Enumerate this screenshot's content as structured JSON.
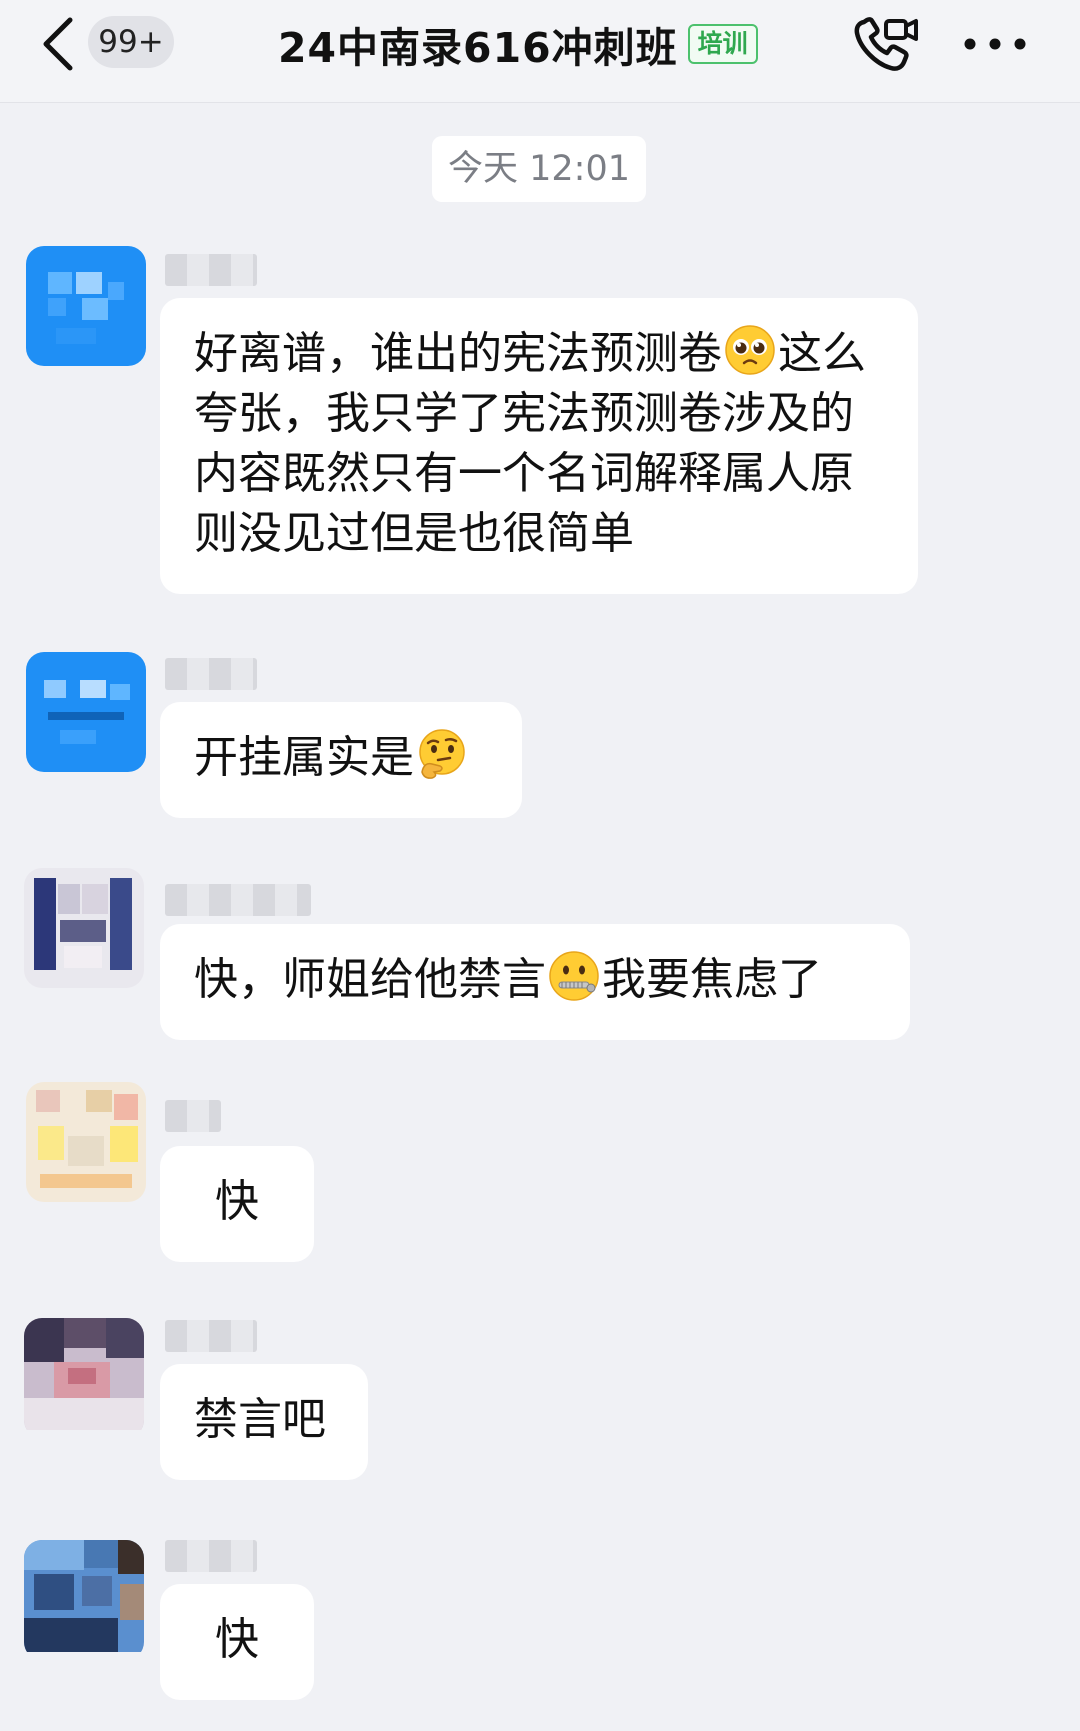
{
  "header": {
    "unread_count": "99+",
    "title": "24中南录616冲刺班",
    "tag": "培训"
  },
  "chat": {
    "timestamp": "今天 12:01",
    "messages": [
      {
        "text_before": "好离谱，谁出的宪法预测卷",
        "emoji": "pleading-face-icon",
        "text_after": "这么夸张，我只学了宪法预测卷涉及的内容既然只有一个名词解释属人原则没见过但是也很简单"
      },
      {
        "text_before": "开挂属实是",
        "emoji": "thinking-face-icon",
        "text_after": ""
      },
      {
        "text_before": "快，师姐给他禁言",
        "emoji": "zipper-mouth-face-icon",
        "text_after": "我要焦虑了"
      },
      {
        "text_before": "快",
        "emoji": "",
        "text_after": ""
      },
      {
        "text_before": "禁言吧",
        "emoji": "",
        "text_after": ""
      },
      {
        "text_before": "快",
        "emoji": "",
        "text_after": ""
      }
    ]
  },
  "colors": {
    "background": "#f0f1f5",
    "bubble": "#ffffff",
    "tag_green": "#2fa84f"
  }
}
